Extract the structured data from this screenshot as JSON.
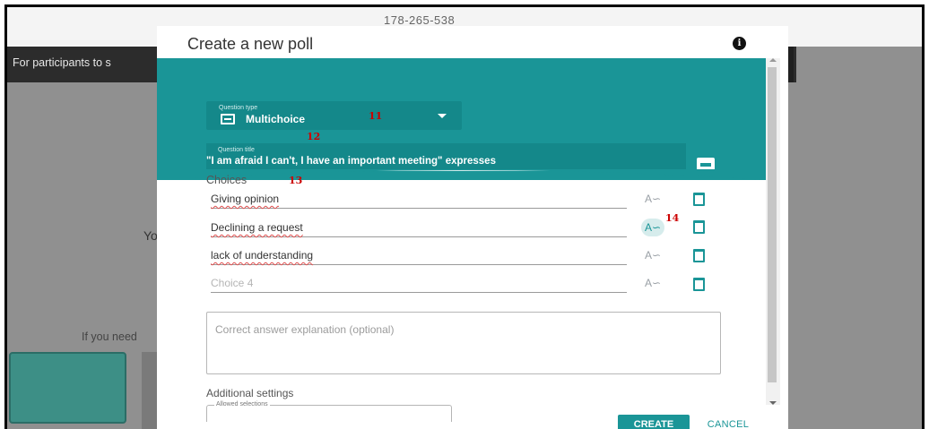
{
  "background": {
    "meeting_id": "178-265-538",
    "banner_text": "For participants to s",
    "partial_text_y": "Yo",
    "partial_text_need": "If you need"
  },
  "dialog": {
    "title": "Create a new poll",
    "info_icon": "info-icon",
    "question_type": {
      "label": "Question type",
      "value": "Multichoice",
      "icon": "list-icon"
    },
    "question_title": {
      "label": "Question title",
      "value": "\"I am afraid I can't, I have an important meeting\" expresses",
      "icon": "image-icon"
    },
    "choices_label": "Choices",
    "choices": [
      {
        "text": "Giving opinion",
        "placeholder": ""
      },
      {
        "text": "Declining a request",
        "placeholder": ""
      },
      {
        "text": "lack of understanding",
        "placeholder": ""
      },
      {
        "text": "",
        "placeholder": "Choice 4"
      }
    ],
    "explanation_placeholder": "Correct answer explanation (optional)",
    "additional_settings": "Additional settings",
    "allowed_selections_label": "Allowed selections",
    "create_label": "CREATE",
    "cancel_label": "CANCEL"
  },
  "annotations": {
    "a11": "11",
    "a12": "12",
    "a13": "13",
    "a14": "14"
  },
  "colors": {
    "teal": "#1a9597",
    "annotation": "#cc0000"
  }
}
